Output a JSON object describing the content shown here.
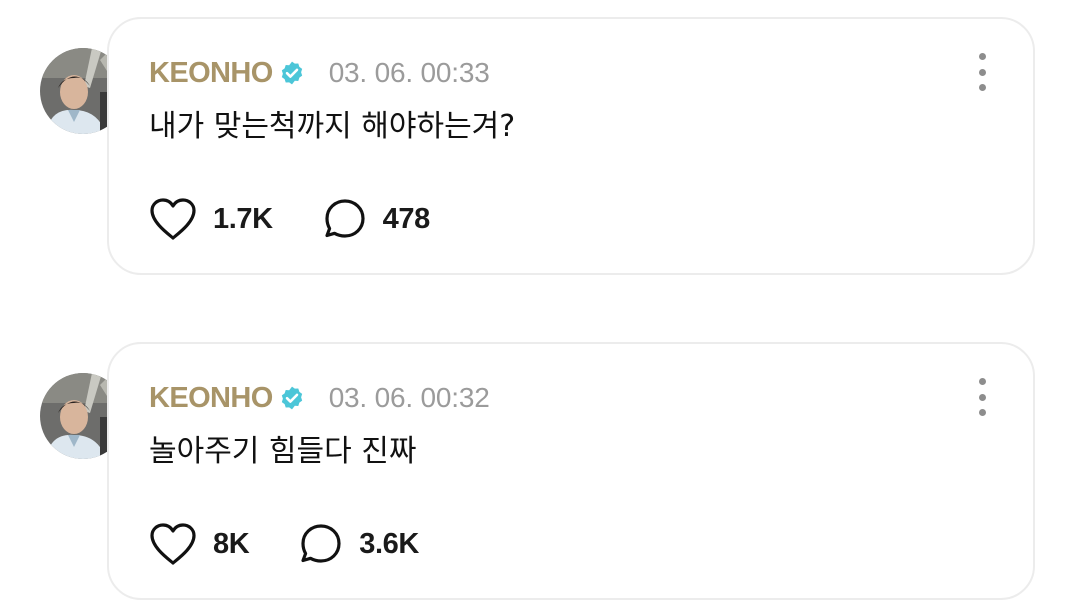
{
  "posts": [
    {
      "author": "KEONHO",
      "verified_icon": "verified-badge-icon",
      "timestamp": "03. 06. 00:33",
      "text": "내가 맞는척까지 해야하는겨?",
      "likes": "1.7K",
      "comments": "478"
    },
    {
      "author": "KEONHO",
      "verified_icon": "verified-badge-icon",
      "timestamp": "03. 06. 00:32",
      "text": "놀아주기 힘들다 진짜",
      "likes": "8K",
      "comments": "3.6K"
    }
  ],
  "icons": {
    "more": "more-vertical-icon",
    "like": "heart-icon",
    "comment": "speech-bubble-icon"
  },
  "colors": {
    "author": "#a89468",
    "verified_badge": "#4cc6d8",
    "timestamp": "#9b9b9b",
    "card_border": "#ececec"
  }
}
